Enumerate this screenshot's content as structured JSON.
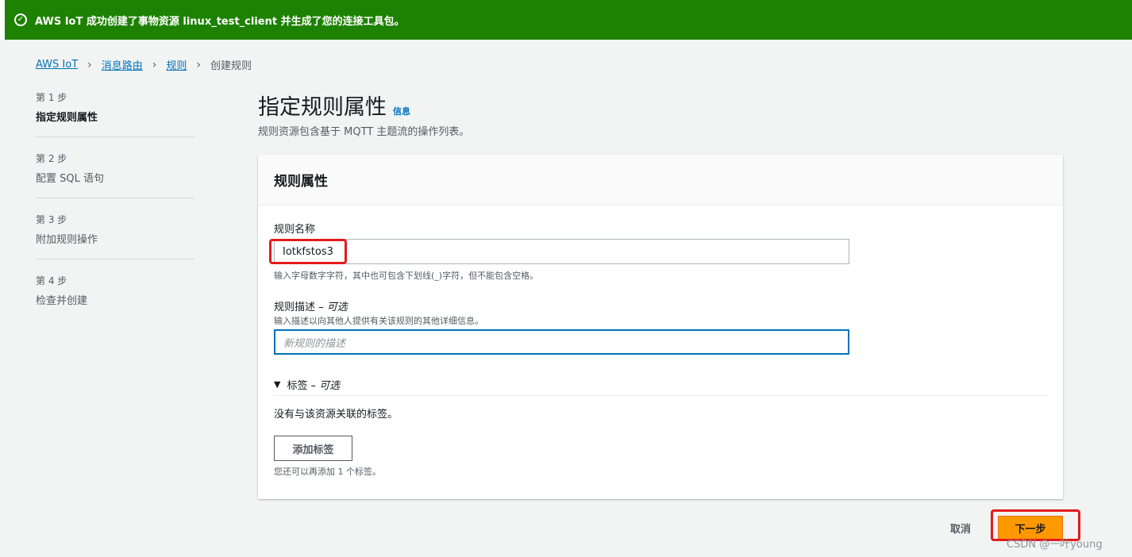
{
  "flash": {
    "icon": "check-circle-icon",
    "message": "AWS IoT 成功创建了事物资源 linux_test_client 并生成了您的连接工具包。",
    "color": "#1d8102"
  },
  "breadcrumb": {
    "items": [
      "AWS IoT",
      "消息路由",
      "规则"
    ],
    "current": "创建规则"
  },
  "steps": [
    {
      "num": "第 1 步",
      "name": "指定规则属性"
    },
    {
      "num": "第 2 步",
      "name": "配置 SQL 语句"
    },
    {
      "num": "第 3 步",
      "name": "附加规则操作"
    },
    {
      "num": "第 4 步",
      "name": "检查并创建"
    }
  ],
  "page": {
    "title": "指定规则属性",
    "info": "信息",
    "subtitle": "规则资源包含基于 MQTT 主题流的操作列表。"
  },
  "panel": {
    "header": "规则属性",
    "name_label": "规则名称",
    "name_value": "Iotkfstos3",
    "name_hint": "输入字母数字字符，其中也可包含下划线(_)字符，但不能包含空格。",
    "desc_label": "规则描述",
    "desc_optional": "– 可选",
    "desc_hint": "输入描述以向其他人提供有关该规则的其他详细信息。",
    "desc_placeholder": "新规则的描述",
    "tags_label": "标签",
    "tags_optional": "– 可选",
    "no_tags": "没有与该资源关联的标签。",
    "add_tag_button": "添加标签",
    "add_tag_hint": "您还可以再添加 1 个标签。"
  },
  "footer": {
    "cancel": "取消",
    "next": "下一步"
  },
  "watermark": "CSDN @一叶young",
  "colors": {
    "accent": "#0073bb",
    "primary_button": "#ff9900",
    "highlight_box": "#e31b1b"
  }
}
